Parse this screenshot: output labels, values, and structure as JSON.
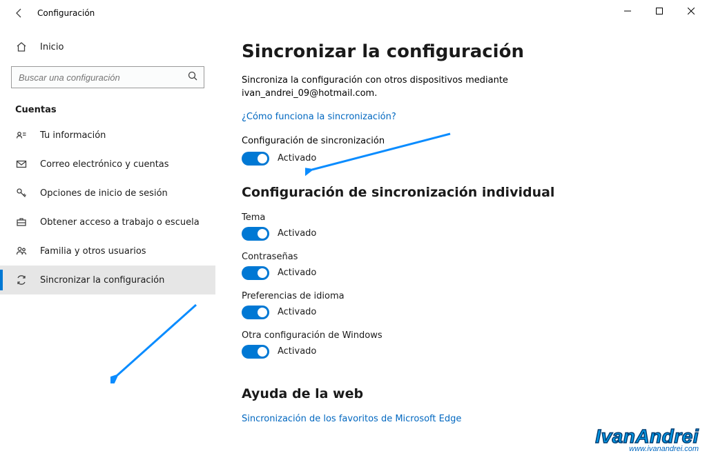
{
  "window": {
    "title": "Configuración"
  },
  "sidebar": {
    "home": "Inicio",
    "search_placeholder": "Buscar una configuración",
    "section": "Cuentas",
    "items": [
      {
        "label": "Tu información"
      },
      {
        "label": "Correo electrónico y cuentas"
      },
      {
        "label": "Opciones de inicio de sesión"
      },
      {
        "label": "Obtener acceso a trabajo o escuela"
      },
      {
        "label": "Familia y otros usuarios"
      },
      {
        "label": "Sincronizar la configuración"
      }
    ]
  },
  "main": {
    "title": "Sincronizar la configuración",
    "desc_line1": "Sincroniza la configuración con otros dispositivos mediante",
    "desc_line2": "ivan_andrei_09@hotmail.com.",
    "help_link": "¿Cómo funciona la sincronización?",
    "master": {
      "label": "Configuración de sincronización",
      "state": "Activado"
    },
    "individual_title": "Configuración de sincronización individual",
    "settings": [
      {
        "label": "Tema",
        "state": "Activado"
      },
      {
        "label": "Contraseñas",
        "state": "Activado"
      },
      {
        "label": "Preferencias de idioma",
        "state": "Activado"
      },
      {
        "label": "Otra configuración de Windows",
        "state": "Activado"
      }
    ],
    "web_help_title": "Ayuda de la web",
    "web_help_link": "Sincronización de los favoritos de Microsoft Edge"
  },
  "watermark": {
    "name": "IvanAndrei",
    "url": "www.ivanandrei.com"
  }
}
